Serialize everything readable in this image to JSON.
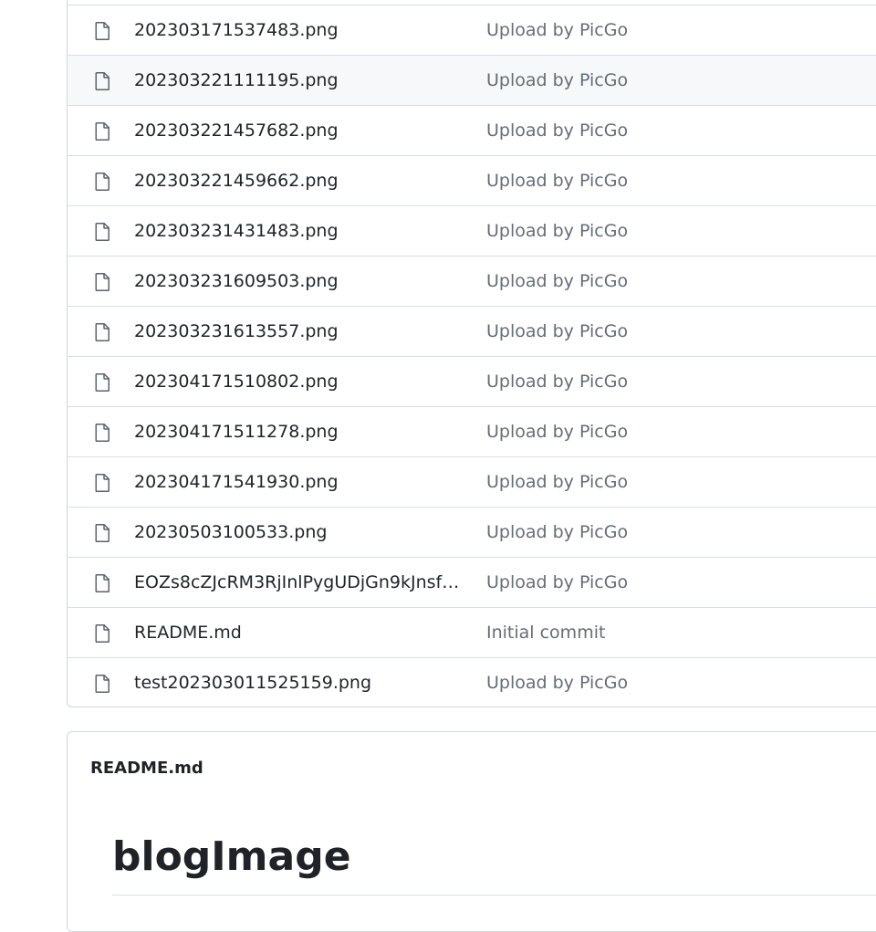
{
  "files": [
    {
      "name": "202303171537483.png",
      "commit": "Upload by PicGo"
    },
    {
      "name": "202303221111195.png",
      "commit": "Upload by PicGo"
    },
    {
      "name": "202303221457682.png",
      "commit": "Upload by PicGo"
    },
    {
      "name": "202303221459662.png",
      "commit": "Upload by PicGo"
    },
    {
      "name": "202303231431483.png",
      "commit": "Upload by PicGo"
    },
    {
      "name": "202303231609503.png",
      "commit": "Upload by PicGo"
    },
    {
      "name": "202303231613557.png",
      "commit": "Upload by PicGo"
    },
    {
      "name": "202304171510802.png",
      "commit": "Upload by PicGo"
    },
    {
      "name": "202304171511278.png",
      "commit": "Upload by PicGo"
    },
    {
      "name": "202304171541930.png",
      "commit": "Upload by PicGo"
    },
    {
      "name": "20230503100533.png",
      "commit": "Upload by PicGo"
    },
    {
      "name": "EOZs8cZJcRM3RjInlPygUDjGn9kJnsfK...",
      "commit": "Upload by PicGo"
    },
    {
      "name": "README.md",
      "commit": "Initial commit"
    },
    {
      "name": "test202303011525159.png",
      "commit": "Upload by PicGo"
    }
  ],
  "readme": {
    "header": "README.md",
    "title": "blogImage"
  },
  "icons": {
    "file": "file-icon"
  },
  "colors": {
    "text": "#1f2328",
    "muted": "#656d76",
    "border": "#d0d7de",
    "row_hover": "#f6f8fa"
  }
}
